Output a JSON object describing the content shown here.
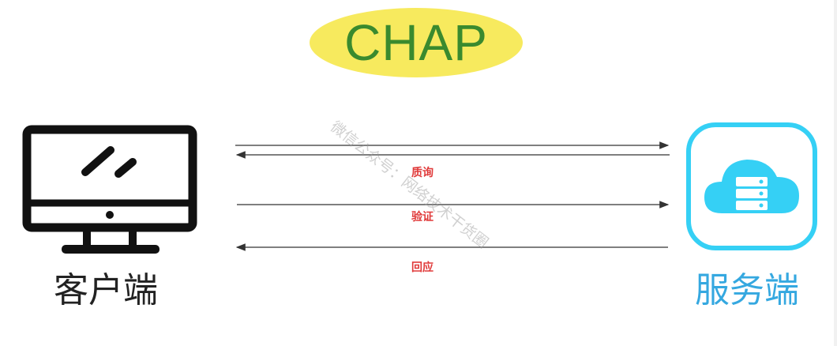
{
  "title": "CHAP",
  "client": {
    "label": "客户端",
    "icon": "desktop-monitor-icon"
  },
  "server": {
    "label": "服务端",
    "icon": "cloud-server-icon"
  },
  "messages": [
    {
      "label": "质询"
    },
    {
      "label": "验证"
    },
    {
      "label": "回应"
    }
  ],
  "watermark": "微信公众号：网络技术干货圈",
  "colors": {
    "title_bg": "#f7ea5e",
    "title_text": "#3a8a2e",
    "server_accent": "#35d0f5",
    "server_label": "#35a8e0",
    "message_text": "#e03a3a"
  }
}
